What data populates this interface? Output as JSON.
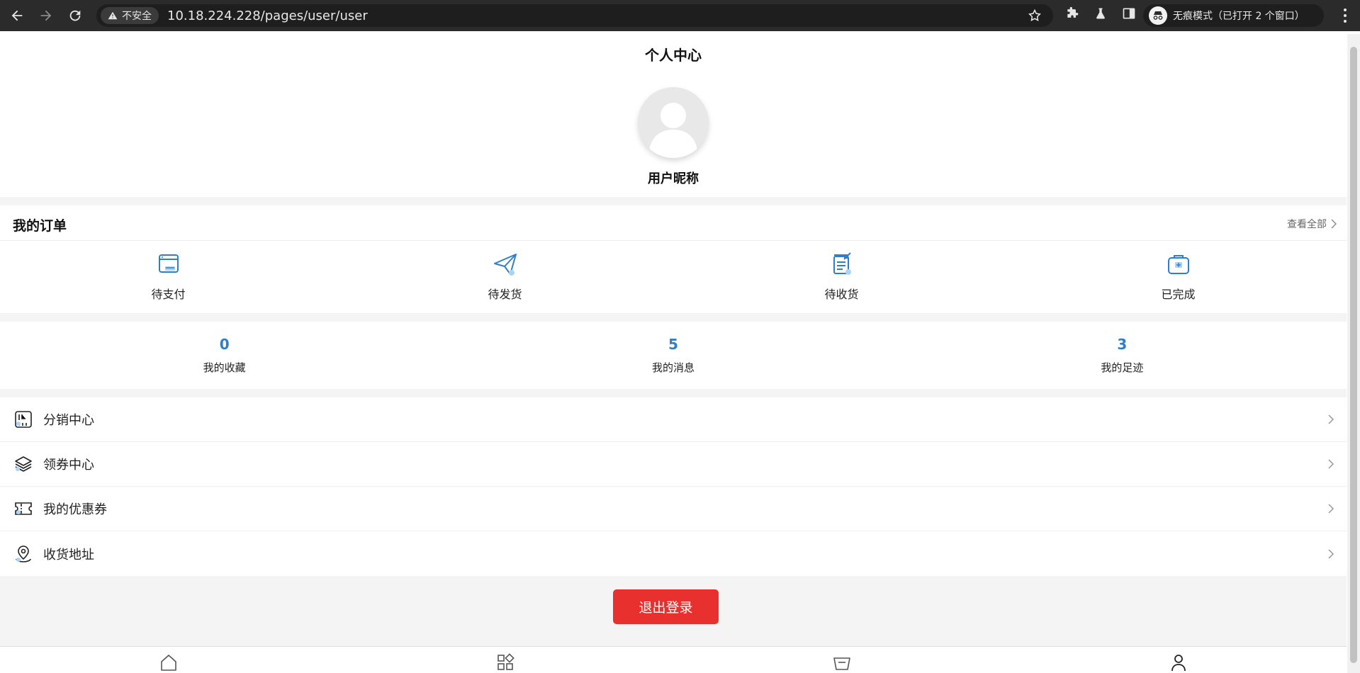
{
  "browser": {
    "security_label": "不安全",
    "url": "10.18.224.228/pages/user/user",
    "incognito_label": "无痕模式（已打开 2 个窗口）"
  },
  "page": {
    "title": "个人中心",
    "nickname": "用户昵称",
    "orders": {
      "title": "我的订单",
      "view_all": "查看全部",
      "items": [
        {
          "label": "待支付",
          "icon": "pending-payment-icon"
        },
        {
          "label": "待发货",
          "icon": "paper-plane-icon"
        },
        {
          "label": "待收货",
          "icon": "document-icon"
        },
        {
          "label": "已完成",
          "icon": "completed-bag-icon"
        }
      ]
    },
    "stats": [
      {
        "value": "0",
        "label": "我的收藏"
      },
      {
        "value": "5",
        "label": "我的消息"
      },
      {
        "value": "3",
        "label": "我的足迹"
      }
    ],
    "menu": [
      {
        "label": "分销中心",
        "icon": "distribution-icon"
      },
      {
        "label": "领券中心",
        "icon": "layers-icon"
      },
      {
        "label": "我的优惠券",
        "icon": "ticket-icon"
      },
      {
        "label": "收货地址",
        "icon": "location-icon"
      }
    ],
    "logout": "退出登录"
  },
  "colors": {
    "accent_blue": "#2f7fc8",
    "logout_red": "#e8312e",
    "icon_blue": "#3a8cd6"
  }
}
